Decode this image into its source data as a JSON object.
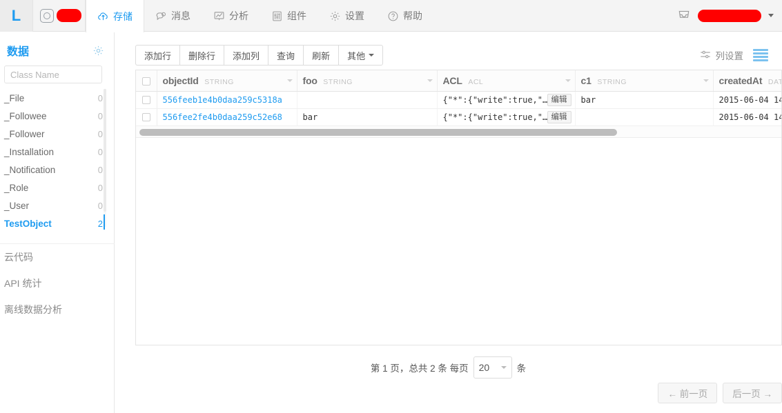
{
  "topnav": {
    "logo_letter": "L",
    "app_icon_name": "app-square-icon",
    "app_name_redacted": "",
    "tabs": [
      {
        "label": "存储",
        "icon": "cloud-upload-icon",
        "active": true
      },
      {
        "label": "消息",
        "icon": "chat-bubbles-icon",
        "active": false
      },
      {
        "label": "分析",
        "icon": "chart-trend-icon",
        "active": false
      },
      {
        "label": "组件",
        "icon": "sliders-icon",
        "active": false
      },
      {
        "label": "设置",
        "icon": "gear-icon",
        "active": false
      },
      {
        "label": "帮助",
        "icon": "question-circle-icon",
        "active": false
      }
    ],
    "inbox_icon": "inbox-tray-icon",
    "user_name_redacted": "",
    "user_caret": "chevron-down-icon"
  },
  "sidebar": {
    "title": "数据",
    "settings_icon": "gear-icon",
    "search_placeholder": "Class Name",
    "search_value": "",
    "classes": [
      {
        "name": "_File",
        "count": "0",
        "active": false
      },
      {
        "name": "_Followee",
        "count": "0",
        "active": false
      },
      {
        "name": "_Follower",
        "count": "0",
        "active": false
      },
      {
        "name": "_Installation",
        "count": "0",
        "active": false
      },
      {
        "name": "_Notification",
        "count": "0",
        "active": false
      },
      {
        "name": "_Role",
        "count": "0",
        "active": false
      },
      {
        "name": "_User",
        "count": "0",
        "active": false
      },
      {
        "name": "TestObject",
        "count": "2",
        "active": true
      }
    ],
    "links": [
      {
        "label": "云代码"
      },
      {
        "label": "API 统计"
      },
      {
        "label": "离线数据分析"
      }
    ]
  },
  "toolbar": {
    "buttons": [
      {
        "label": "添加行"
      },
      {
        "label": "删除行"
      },
      {
        "label": "添加列"
      },
      {
        "label": "查询"
      },
      {
        "label": "刷新"
      },
      {
        "label": "其他",
        "has_caret": true
      }
    ],
    "column_settings_label": "列设置",
    "column_settings_icon": "sliders-icon",
    "rows_view_icon": "rows-list-icon"
  },
  "table": {
    "columns": [
      {
        "name": "objectId",
        "type": "STRING"
      },
      {
        "name": "foo",
        "type": "STRING"
      },
      {
        "name": "ACL",
        "type": "ACL"
      },
      {
        "name": "c1",
        "type": "STRING"
      },
      {
        "name": "createdAt",
        "type": "DATE"
      }
    ],
    "acl_edit_label": "编辑",
    "rows": [
      {
        "objectId": "556feeb1e4b0daa259c5318a",
        "foo": "",
        "ACL": "{\"*\":{\"write\":true,\"…",
        "c1": "bar",
        "createdAt": "2015-06-04 14"
      },
      {
        "objectId": "556fee2fe4b0daa259c52e68",
        "foo": "bar",
        "ACL": "{\"*\":{\"write\":true,\"…",
        "c1": "",
        "createdAt": "2015-06-04 14"
      }
    ]
  },
  "pagination": {
    "summary_prefix": "第 1 页，总共 2 条 每页",
    "page_size": "20",
    "summary_suffix": "条",
    "prev_label": "← 前一页",
    "next_label": "后一页 →"
  },
  "colors": {
    "accent": "#1e9bf0",
    "redaction": "#ff0000",
    "header_bg": "#f4f4f4",
    "border": "#e4e4e4"
  }
}
